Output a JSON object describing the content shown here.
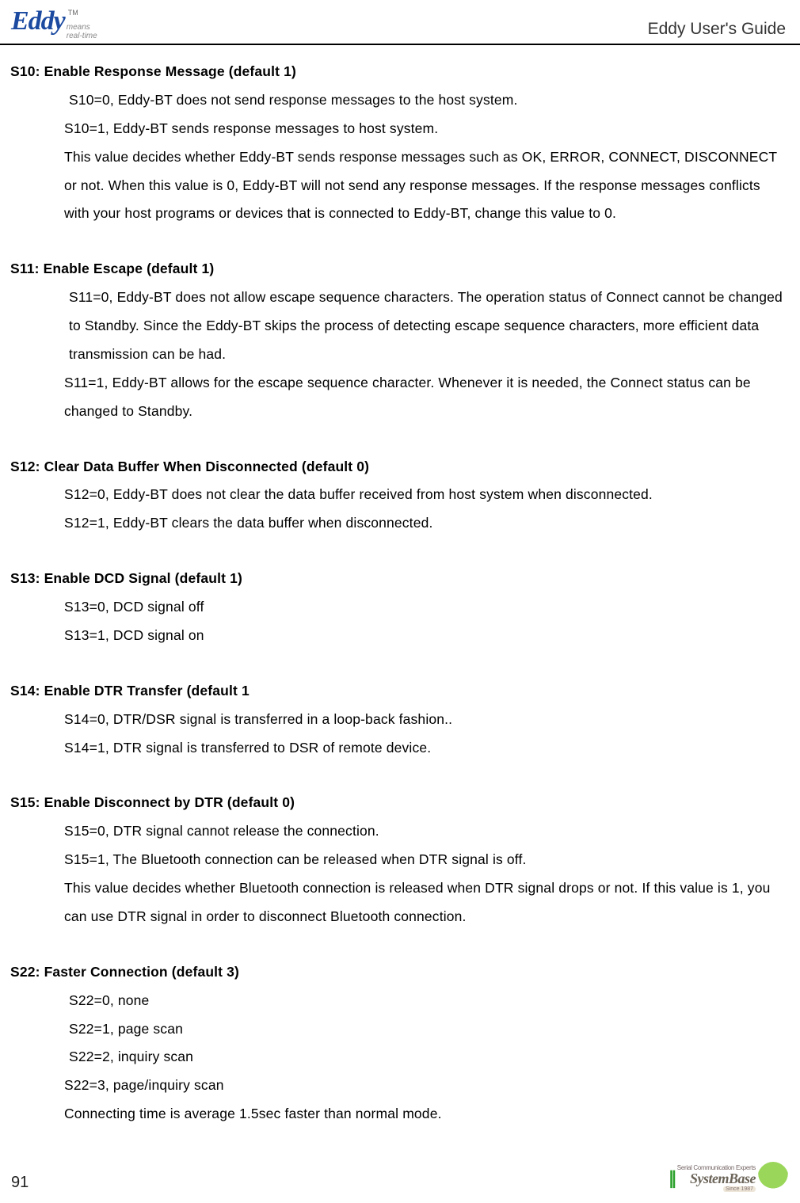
{
  "header": {
    "logo_main": "Eddy",
    "logo_tm": "TM",
    "logo_tag_line1": "means",
    "logo_tag_line2": "real-time",
    "title": "Eddy User's Guide"
  },
  "sections": {
    "s10": {
      "heading": "S10: Enable Response Message (default 1)",
      "p1": "S10=0, Eddy-BT does not send response messages to the host system.",
      "p2": "S10=1, Eddy-BT sends response messages to host system.",
      "p3": "This value decides whether Eddy-BT sends response messages such as OK, ERROR, CONNECT, DISCONNECT or not. When this value is 0, Eddy-BT will not send any response messages. If the response messages conflicts with your host programs or devices that is connected to Eddy-BT, change this value to 0."
    },
    "s11": {
      "heading": "S11: Enable Escape (default 1)",
      "p1": "S11=0, Eddy-BT does not allow escape sequence characters. The operation status of Connect cannot be changed to Standby. Since the Eddy-BT skips the process of detecting escape sequence characters, more efficient data transmission can be had.",
      "p2": "S11=1, Eddy-BT allows for the escape sequence character. Whenever it is needed, the Connect status can be changed to Standby."
    },
    "s12": {
      "heading": "S12: Clear Data Buffer When Disconnected (default 0)",
      "p1": "S12=0, Eddy-BT does not clear the data buffer received from host system when disconnected.",
      "p2": "S12=1, Eddy-BT clears the data buffer when disconnected."
    },
    "s13": {
      "heading": "S13: Enable DCD Signal (default 1)",
      "p1": "S13=0, DCD signal off",
      "p2": "S13=1, DCD signal on"
    },
    "s14": {
      "heading": "S14: Enable DTR Transfer (default 1",
      "p1": "S14=0, DTR/DSR signal is transferred in a loop-back fashion..",
      "p2": "S14=1, DTR signal is transferred to DSR of remote device."
    },
    "s15": {
      "heading": "S15: Enable Disconnect by DTR (default 0)",
      "p1": "S15=0, DTR signal cannot release the connection.",
      "p2": "S15=1, The Bluetooth connection can be released when DTR signal is off.",
      "p3": "This value decides whether Bluetooth connection is released when DTR signal drops or not. If this value is 1, you can use DTR signal in order to disconnect Bluetooth connection."
    },
    "s22": {
      "heading": "S22: Faster Connection (default 3)",
      "p1": "S22=0, none",
      "p2": "S22=1, page scan",
      "p3": "S22=2, inquiry scan",
      "p4": "S22=3, page/inquiry scan",
      "p5": "Connecting time is average 1.5sec faster than normal mode."
    }
  },
  "footer": {
    "page_number": "91",
    "expert": "Serial Communication Experts",
    "brand": "SystemBase",
    "since": "Since 1987"
  }
}
